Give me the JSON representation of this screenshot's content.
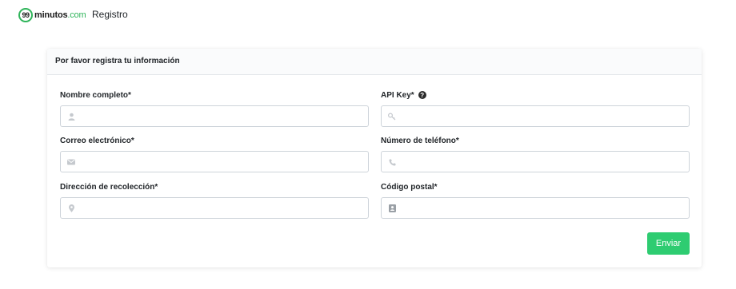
{
  "nav": {
    "logo_number": "99",
    "logo_name": "minutos",
    "logo_domain": ".com",
    "registro_label": "Registro"
  },
  "card": {
    "title": "Por favor registra tu información"
  },
  "form": {
    "nombre_label": "Nombre completo*",
    "nombre_value": "",
    "correo_label": "Correo electrónico*",
    "correo_value": "",
    "direccion_label": "Dirección de recolección*",
    "direccion_value": "",
    "apikey_label": "API Key*",
    "apikey_value": "",
    "telefono_label": "Número de teléfono*",
    "telefono_value": "",
    "cp_label": "Código postal*",
    "cp_value": "",
    "help_glyph": "?",
    "submit_label": "Enviar"
  },
  "icons": {
    "nombre": "user-icon",
    "correo": "envelope-icon",
    "direccion": "map-marker-icon",
    "apikey": "key-icon",
    "telefono": "phone-icon",
    "cp": "address-card-icon",
    "help": "question-circle-icon"
  },
  "colors": {
    "accent": "#2ecc71",
    "brand_green": "#2fb45a",
    "icon_gray": "#c5c9ce"
  }
}
